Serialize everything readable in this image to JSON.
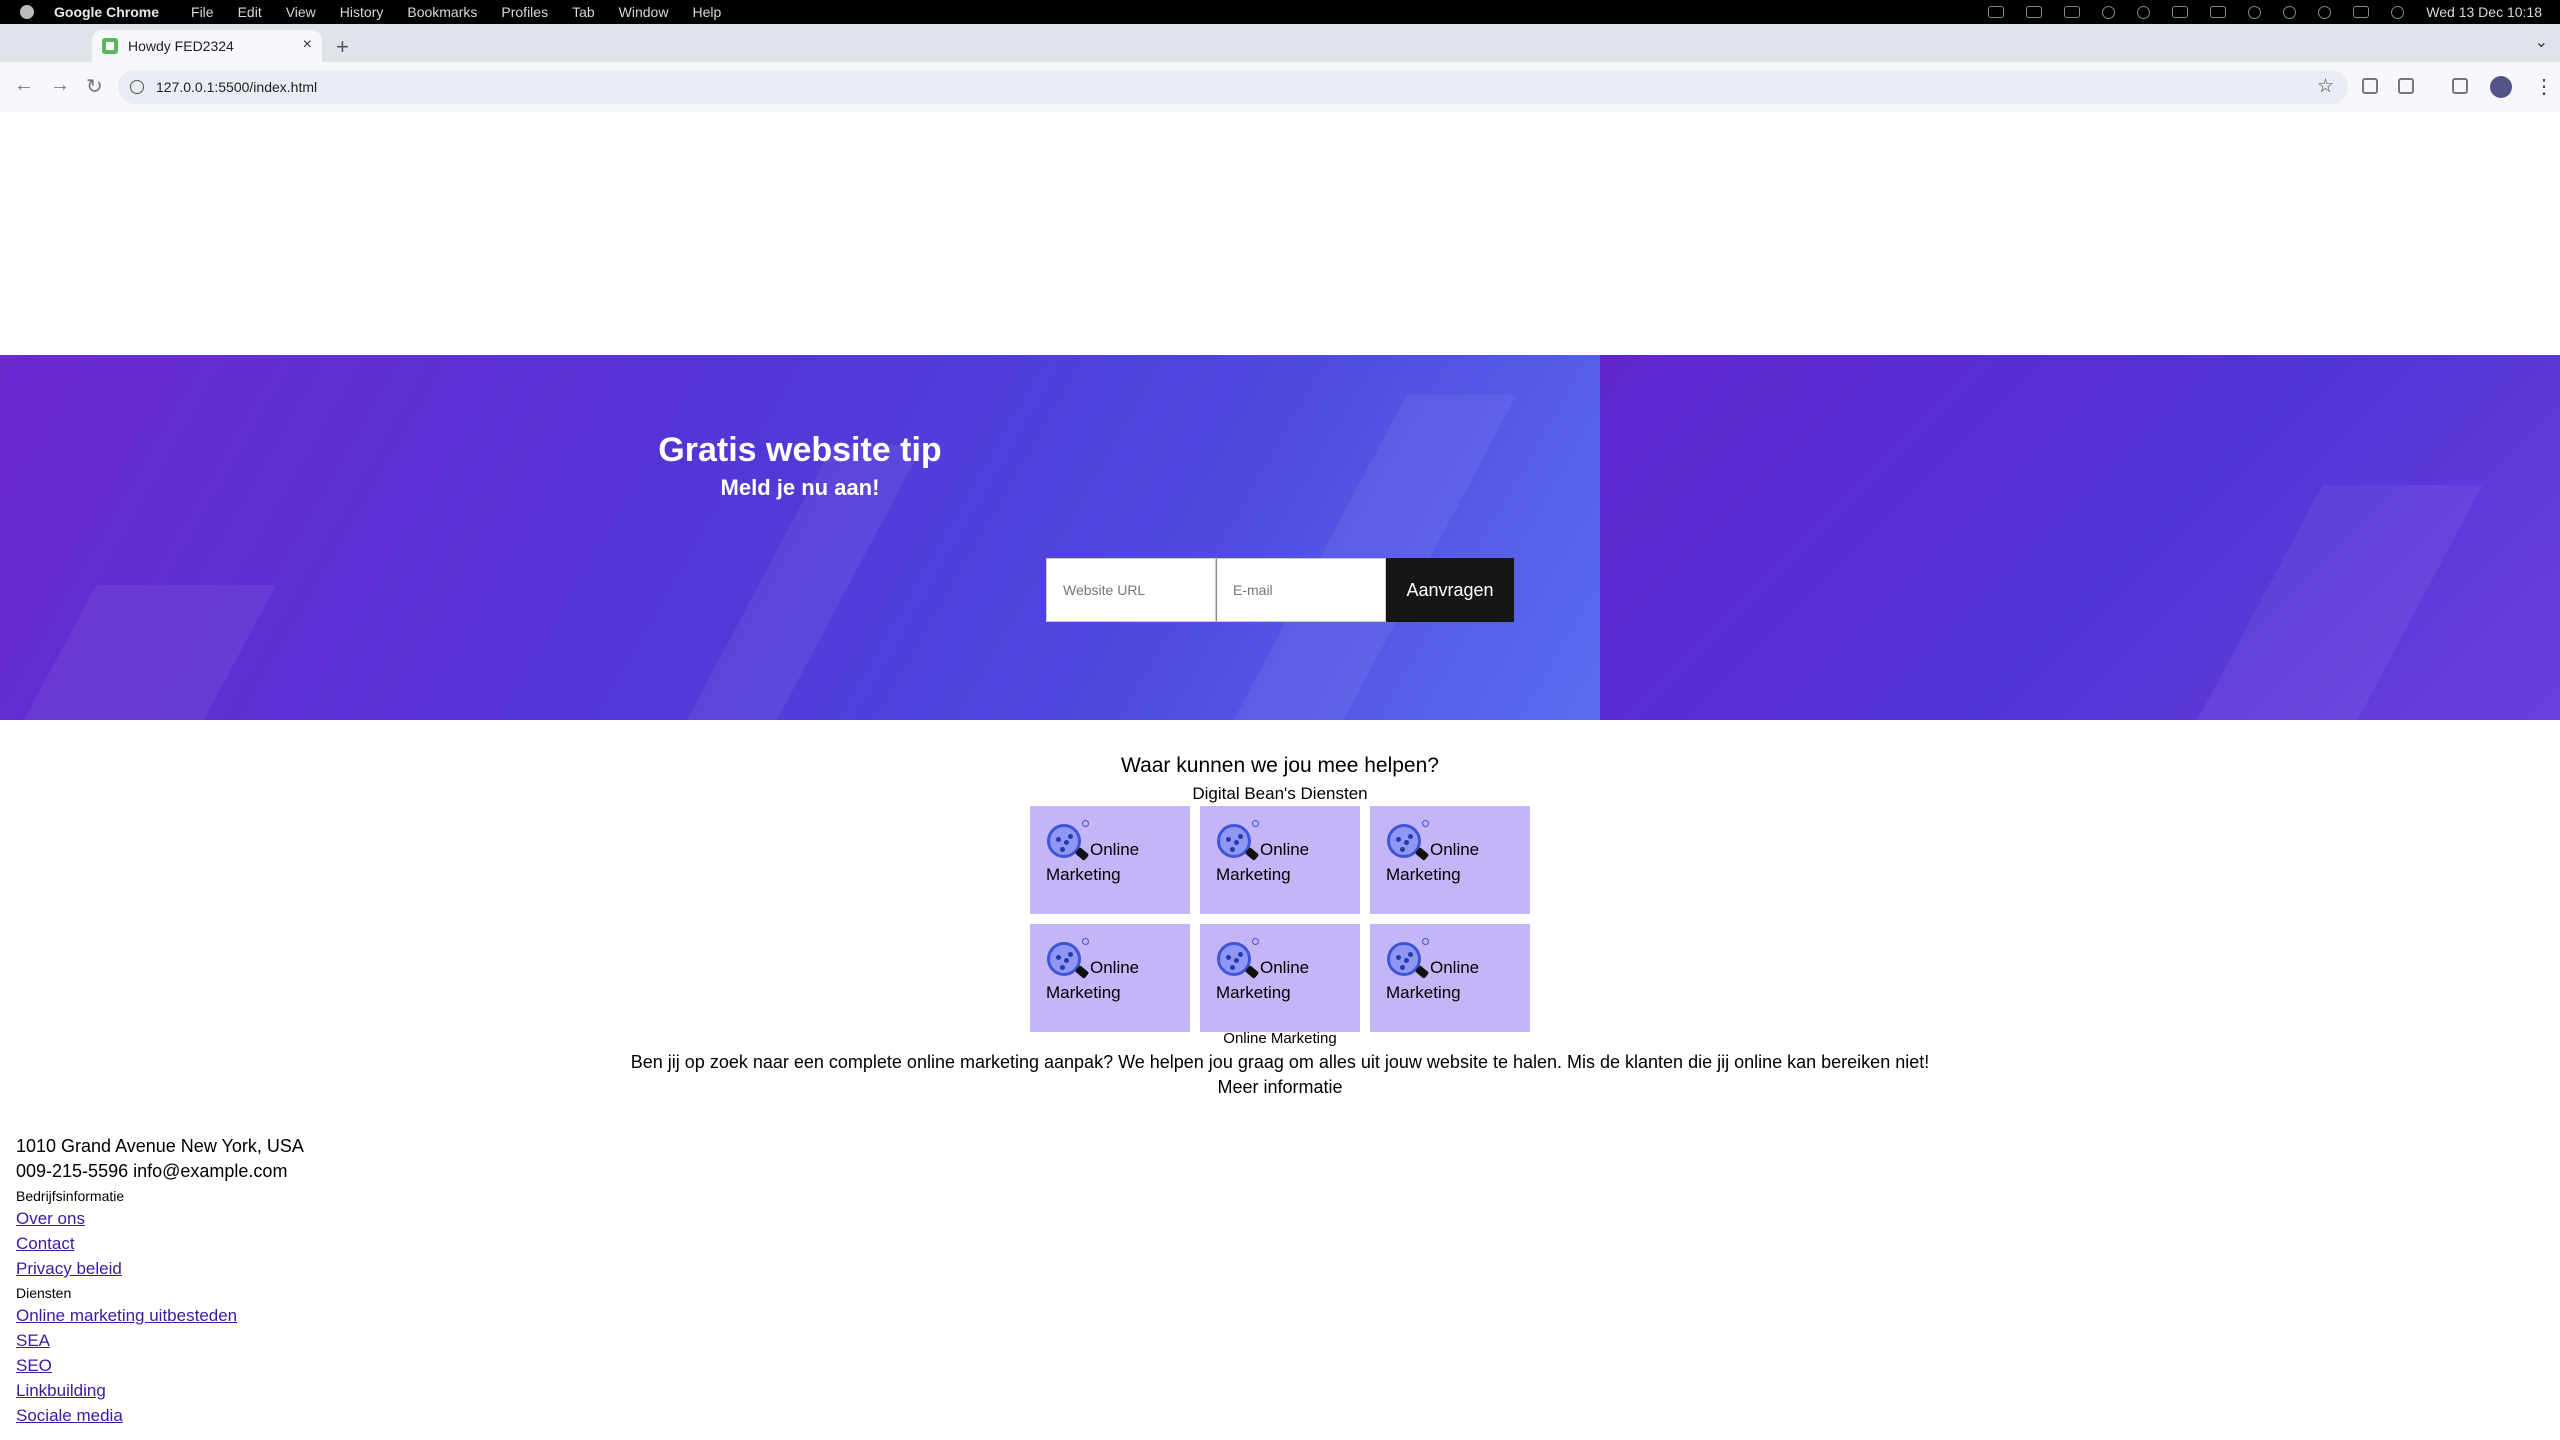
{
  "menubar": {
    "app_name": "Google Chrome",
    "menus": [
      "File",
      "Edit",
      "View",
      "History",
      "Bookmarks",
      "Profiles",
      "Tab",
      "Window",
      "Help"
    ],
    "clock": "Wed 13 Dec  10:18"
  },
  "browser": {
    "tab_title": "Howdy FED2324",
    "tab_close": "×",
    "new_tab": "+",
    "tab_list": "⌄",
    "url": "127.0.0.1:5500/index.html",
    "back": "←",
    "forward": "→",
    "reload": "↻",
    "star": "☆",
    "menu": "⋮"
  },
  "hero": {
    "title": "Gratis website tip",
    "subtitle": "Meld je nu aan!",
    "url_placeholder": "Website URL",
    "email_placeholder": "E-mail",
    "submit_label": "Aanvragen",
    "colors": {
      "gradient_start": "#6d2ad1",
      "gradient_end": "#5a6cf0",
      "button": "#161616"
    }
  },
  "services": {
    "title": "Waar kunnen we jou mee helpen?",
    "subtitle": "Digital Bean's Diensten",
    "cards": [
      {
        "label": "Online Marketing"
      },
      {
        "label": "Online Marketing"
      },
      {
        "label": "Online Marketing"
      },
      {
        "label": "Online Marketing"
      },
      {
        "label": "Online Marketing"
      },
      {
        "label": "Online Marketing"
      }
    ],
    "card_color": "#c4b5f7",
    "caption": "Online Marketing",
    "description": "Ben jij op zoek naar een complete online marketing aanpak? We helpen jou graag om alles uit jouw website te halen. Mis de klanten die jij online kan bereiken niet!",
    "more_label": "Meer informatie"
  },
  "footer": {
    "address": "1010 Grand Avenue New York, USA",
    "contact": "009-215-5596 info@example.com",
    "company_heading": "Bedrijfsinformatie",
    "company_links": [
      "Over ons",
      "Contact",
      "Privacy beleid"
    ],
    "services_heading": "Diensten",
    "services_links": [
      "Online marketing uitbesteden",
      "SEA",
      "SEO",
      "Linkbuilding",
      "Sociale media"
    ]
  }
}
